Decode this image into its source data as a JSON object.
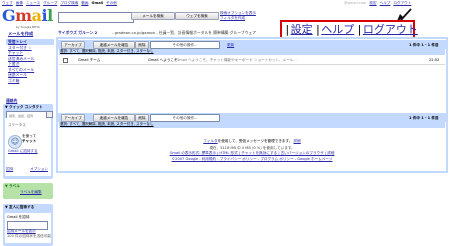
{
  "top_nav": [
    "ウェブ",
    "画像",
    "ニュース",
    "グループ",
    "ブログ検索",
    "動画",
    "Gmail",
    "その他"
  ],
  "right_links": [
    "@gmail.com",
    "設定",
    "ヘルプ",
    "ログアウト"
  ],
  "logo": {
    "letters": [
      "G",
      "m",
      "a",
      "i",
      "l"
    ],
    "subtitle": "by Google BETA"
  },
  "search": {
    "input_value": "",
    "mail_button": "メールを検索",
    "web_button": "ウェブを検索",
    "options_link": "検索オプションを表示",
    "filter_link": "フィルタを作成"
  },
  "callout": {
    "settings": "設定",
    "help": "ヘルプ",
    "logout": "ログアウト",
    "separator": "|"
  },
  "sidebar": {
    "compose": "メールを作成",
    "items": [
      "受信トレイ",
      "スター付き ☆",
      "チャット",
      "送信済みメール",
      "下書き",
      "すべてのメール",
      "迷惑メール",
      "ゴミ箱"
    ],
    "contacts": "連絡先",
    "quick_contacts": {
      "header": "▼ クイック コンタクト",
      "search_placeholder": "検索、追加、招待",
      "status": "ステータス",
      "chat_line1": "を使って",
      "chat_line2": "チャット",
      "invite_link": "Gmail に招待する",
      "invite_short": "招待",
      "options": "オプション"
    },
    "labels": {
      "header": "▼ ラベル",
      "edit": "ラベルを編集"
    },
    "invite": {
      "header": "▼ 友人に招待する",
      "label": "Gmail を招待",
      "preview": "招待メールを表示",
      "remaining": "100 件の招待状を送信可能"
    }
  },
  "banner": {
    "sponsor": "サイボウズ ガルーン 2",
    "text": "- gradeon.co.jp/garoon - 社員一覧、計画情報ポータルを 簡単構築 グループウェア"
  },
  "toolbar": {
    "archive": "アーカイブ",
    "spam": "迷惑メールを報告",
    "delete": "削除",
    "more_actions": "その他の操作...",
    "refresh": "更新",
    "count": "1 件中 1 - 1 件目"
  },
  "select_row": "選択: すべて, 選択解除, 既読, 未読, スター付き, スターなし",
  "email_rows": [
    {
      "sender": "Gmail チーム",
      "subject": "Gmail へようこそ",
      "snippet": "- Gmail へようこそ。チャット機能やキーボード ショートカット、メール...",
      "time": "22:02"
    }
  ],
  "footer": {
    "line1_link": "フィルタ",
    "line1_text": "を使用して、受信メッセージを管理できます。",
    "line1_more": "詳細",
    "line2": "現在、5118 MB 中 0 MB (0 %) を使用しています。",
    "line3": "Gmail の表示形式: 標準表示 | HTML 形式 | チャットを無効にする | 古いバージョンのブラウザ | 詳細",
    "line4": "©2007 Google - 利用規約 - プライバシー ポリシー - プログラム ポリシー - Google ホームページ"
  }
}
